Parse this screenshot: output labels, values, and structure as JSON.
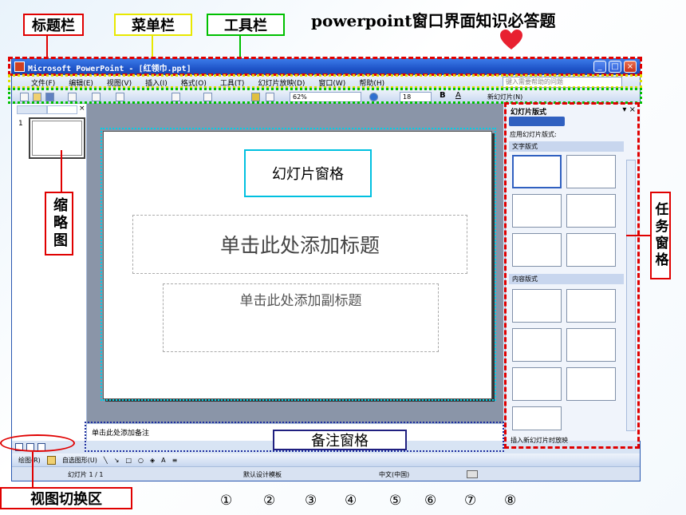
{
  "heading": "powerpoint窗口界面知识必答题",
  "labels": {
    "title_bar": "标题栏",
    "menu_bar": "菜单栏",
    "toolbar": "工具栏",
    "thumbnail": "缩略图",
    "task_pane": "任务窗格",
    "slide_pane": "幻灯片窗格",
    "notes_pane": "备注窗格",
    "view_switch": "视图切换区"
  },
  "window": {
    "title": "Microsoft PowerPoint - [红领巾.ppt]",
    "menu": [
      "文件(F)",
      "编辑(E)",
      "视图(V)",
      "插入(I)",
      "格式(O)",
      "工具(T)",
      "幻灯片放映(D)",
      "窗口(W)",
      "帮助(H)"
    ],
    "help_placeholder": "键入需要帮助的问题",
    "zoom": "62%",
    "font_size": "18",
    "new_slide": "新幻灯片(N)",
    "slide_number": "1"
  },
  "slide": {
    "title_placeholder": "单击此处添加标题",
    "subtitle_placeholder": "单击此处添加副标题"
  },
  "notes_placeholder": "单击此处添加备注",
  "task_pane": {
    "title": "幻灯片版式",
    "apply_label": "应用幻灯片版式:",
    "section_text": "文字版式",
    "section_content": "内容版式",
    "checkbox_label": "插入新幻灯片时放映"
  },
  "drawing": {
    "draw_label": "绘图(R)",
    "autoshape_label": "自选图形(U)"
  },
  "status": {
    "slide_info": "幻灯片 1 / 1",
    "template": "默认设计模板",
    "language": "中文(中国)"
  },
  "numbers": [
    "①",
    "②",
    "③",
    "④",
    "⑤",
    "⑥",
    "⑦",
    "⑧"
  ],
  "colors": {
    "red": "#e00000",
    "yellow": "#e8e800",
    "green": "#00c000",
    "cyan": "#00c0e0",
    "navy": "#202080",
    "heart": "#e82030"
  }
}
